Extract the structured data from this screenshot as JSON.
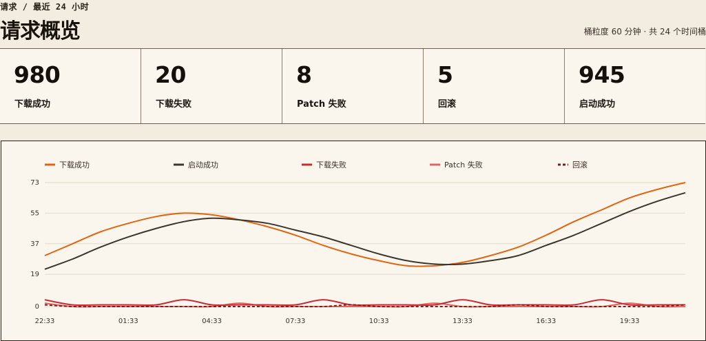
{
  "header": {
    "breadcrumb": "请求 / 最近 24 小时",
    "title": "请求概览",
    "bucket_info": "桶粒度 60 分钟 · 共 24 个时间桶"
  },
  "stats": [
    {
      "value": "980",
      "label": "下载成功"
    },
    {
      "value": "20",
      "label": "下载失败"
    },
    {
      "value": "8",
      "label": "Patch 失败"
    },
    {
      "value": "5",
      "label": "回滚"
    },
    {
      "value": "945",
      "label": "启动成功"
    }
  ],
  "colors": {
    "download_success": "#e3640f",
    "launch_success": "#3b352d",
    "download_fail": "#c62b36",
    "patch_fail": "#e0645c",
    "rollback": "#7a1c22",
    "grid": "#e2d9ca"
  },
  "chart_data": {
    "type": "line",
    "title": "",
    "xlabel": "",
    "ylabel": "",
    "ylim": [
      0,
      73
    ],
    "yticks": [
      0,
      19,
      37,
      55,
      73
    ],
    "x": [
      "22:33",
      "23:33",
      "00:33",
      "01:33",
      "02:33",
      "03:33",
      "04:33",
      "05:33",
      "06:33",
      "07:33",
      "08:33",
      "09:33",
      "10:33",
      "11:33",
      "12:33",
      "13:33",
      "14:33",
      "15:33",
      "16:33",
      "17:33",
      "18:33",
      "19:33",
      "20:33",
      "21:33"
    ],
    "xticks": [
      "22:33",
      "01:33",
      "04:33",
      "07:33",
      "10:33",
      "13:33",
      "16:33",
      "19:33"
    ],
    "legend_position": "top",
    "series": [
      {
        "name": "下载成功",
        "key": "download_success",
        "style": "solid",
        "values": [
          30,
          37,
          44,
          49,
          53,
          55,
          54,
          51,
          47,
          42,
          36,
          31,
          27,
          24,
          24,
          26,
          30,
          35,
          42,
          50,
          57,
          64,
          69,
          73
        ]
      },
      {
        "name": "启动成功",
        "key": "launch_success",
        "style": "solid",
        "values": [
          22,
          28,
          35,
          41,
          46,
          50,
          52,
          51,
          49,
          45,
          41,
          36,
          31,
          27,
          25,
          25,
          27,
          30,
          36,
          42,
          49,
          56,
          62,
          67
        ]
      },
      {
        "name": "下载失败",
        "key": "download_fail",
        "style": "solid",
        "values": [
          4,
          1,
          1,
          1,
          1,
          4,
          1,
          1,
          1,
          1,
          4,
          1,
          1,
          1,
          1,
          4,
          1,
          1,
          1,
          1,
          4,
          1,
          1,
          1
        ]
      },
      {
        "name": "Patch 失败",
        "key": "patch_fail",
        "style": "solid",
        "values": [
          2,
          0,
          0,
          0,
          0,
          0,
          0,
          2,
          0,
          0,
          0,
          0,
          0,
          0,
          2,
          0,
          0,
          0,
          0,
          0,
          0,
          2,
          0,
          0
        ]
      },
      {
        "name": "回滚",
        "key": "rollback",
        "style": "dashed",
        "values": [
          1,
          0,
          0,
          0,
          0,
          0,
          0,
          0,
          0,
          0,
          0,
          1,
          0,
          0,
          0,
          0,
          0,
          1,
          0,
          0,
          0,
          0,
          0,
          1
        ]
      }
    ]
  }
}
